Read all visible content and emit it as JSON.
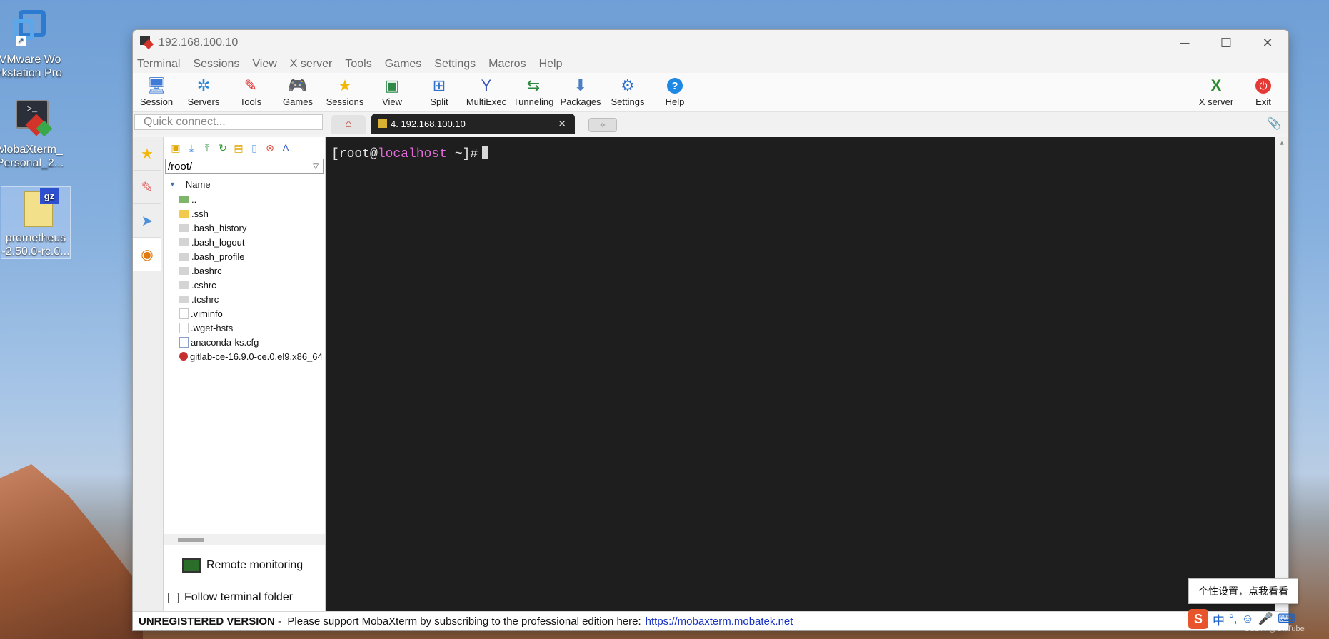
{
  "desktop": {
    "icons": [
      {
        "label": "VMware Workstation Pro",
        "lines": [
          "VMware Wo",
          "rkstation Pro"
        ]
      },
      {
        "label": "MobaXterm_Personal_2...",
        "lines": [
          "MobaXterm_",
          "Personal_2..."
        ]
      },
      {
        "label": "prometheus-2.50.0-rc.0...",
        "lines": [
          "prometheus",
          "-2.50.0-rc.0..."
        ]
      }
    ]
  },
  "window": {
    "title": "192.168.100.10",
    "menu": [
      "Terminal",
      "Sessions",
      "View",
      "X server",
      "Tools",
      "Games",
      "Settings",
      "Macros",
      "Help"
    ],
    "toolbar": [
      {
        "label": "Session",
        "icon": "session-icon"
      },
      {
        "label": "Servers",
        "icon": "servers-icon"
      },
      {
        "label": "Tools",
        "icon": "tools-icon"
      },
      {
        "label": "Games",
        "icon": "games-icon"
      },
      {
        "label": "Sessions",
        "icon": "sessions-icon"
      },
      {
        "label": "View",
        "icon": "view-icon"
      },
      {
        "label": "Split",
        "icon": "split-icon"
      },
      {
        "label": "MultiExec",
        "icon": "multiexec-icon"
      },
      {
        "label": "Tunneling",
        "icon": "tunneling-icon"
      },
      {
        "label": "Packages",
        "icon": "packages-icon"
      },
      {
        "label": "Settings",
        "icon": "settings-icon"
      },
      {
        "label": "Help",
        "icon": "help-icon"
      }
    ],
    "toolbar_right": [
      {
        "label": "X server",
        "icon": "x-server-icon"
      },
      {
        "label": "Exit",
        "icon": "power-icon"
      }
    ],
    "quick_connect_placeholder": "Quick connect...",
    "active_tab": "4. 192.168.100.10",
    "file_browser": {
      "path": "/root/",
      "column_name": "Name",
      "files": [
        {
          "name": "..",
          "type": "up"
        },
        {
          "name": ".ssh",
          "type": "folder"
        },
        {
          "name": ".bash_history",
          "type": "file"
        },
        {
          "name": ".bash_logout",
          "type": "file"
        },
        {
          "name": ".bash_profile",
          "type": "file"
        },
        {
          "name": ".bashrc",
          "type": "file"
        },
        {
          "name": ".cshrc",
          "type": "file"
        },
        {
          "name": ".tcshrc",
          "type": "file"
        },
        {
          "name": ".viminfo",
          "type": "doc"
        },
        {
          "name": ".wget-hsts",
          "type": "doc"
        },
        {
          "name": "anaconda-ks.cfg",
          "type": "cfg"
        },
        {
          "name": "gitlab-ce-16.9.0-ce.0.el9.x86_64",
          "type": "rpm"
        }
      ],
      "remote_monitoring": "Remote monitoring",
      "follow_terminal_folder": "Follow terminal folder"
    },
    "terminal": {
      "prompt_open": "[root@",
      "prompt_host": "localhost",
      "prompt_close": " ~]#"
    },
    "status": {
      "unregistered": "UNREGISTERED VERSION",
      "message": " -  Please support MobaXterm by subscribing to the professional edition here:",
      "link": "https://mobaxterm.mobatek.net"
    }
  },
  "taskbar": {
    "tooltip": "个性设置，点我看看",
    "ime_label": "中",
    "watermark": "CSDN @OnTube"
  }
}
